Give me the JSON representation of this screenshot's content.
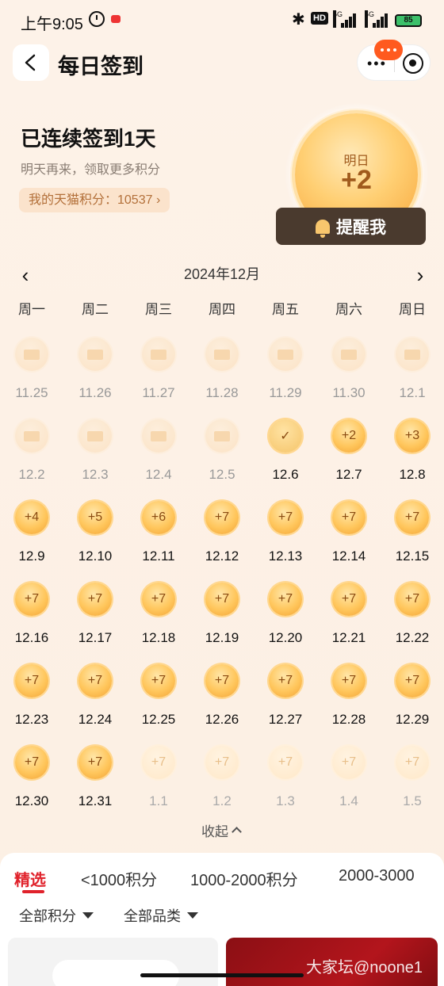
{
  "status_bar": {
    "time": "上午9:05",
    "hd": "HD",
    "net1": "5G",
    "net2": "5G",
    "battery": "85"
  },
  "header": {
    "title": "每日签到"
  },
  "summary": {
    "streak_title": "已连续签到1天",
    "subtitle": "明天再来，领取更多积分",
    "points_label": "我的天猫积分：10537 ›"
  },
  "big_coin": {
    "label": "明日",
    "value": "+2"
  },
  "remind_button": "提醒我",
  "calendar": {
    "month": "2024年12月",
    "prev": "‹",
    "next": "›",
    "weekdays": [
      "周一",
      "周二",
      "周三",
      "周四",
      "周五",
      "周六",
      "周日"
    ],
    "rows": [
      [
        {
          "date": "11.25",
          "reward": "",
          "state": "envelope"
        },
        {
          "date": "11.26",
          "reward": "",
          "state": "envelope"
        },
        {
          "date": "11.27",
          "reward": "",
          "state": "envelope"
        },
        {
          "date": "11.28",
          "reward": "",
          "state": "envelope"
        },
        {
          "date": "11.29",
          "reward": "",
          "state": "envelope"
        },
        {
          "date": "11.30",
          "reward": "",
          "state": "envelope"
        },
        {
          "date": "12.1",
          "reward": "",
          "state": "envelope"
        }
      ],
      [
        {
          "date": "12.2",
          "reward": "",
          "state": "envelope"
        },
        {
          "date": "12.3",
          "reward": "",
          "state": "envelope"
        },
        {
          "date": "12.4",
          "reward": "",
          "state": "envelope"
        },
        {
          "date": "12.5",
          "reward": "",
          "state": "envelope"
        },
        {
          "date": "12.6",
          "reward": "✓",
          "state": "check"
        },
        {
          "date": "12.7",
          "reward": "+2",
          "state": "active"
        },
        {
          "date": "12.8",
          "reward": "+3",
          "state": "active"
        }
      ],
      [
        {
          "date": "12.9",
          "reward": "+4",
          "state": "active"
        },
        {
          "date": "12.10",
          "reward": "+5",
          "state": "active"
        },
        {
          "date": "12.11",
          "reward": "+6",
          "state": "active"
        },
        {
          "date": "12.12",
          "reward": "+7",
          "state": "active"
        },
        {
          "date": "12.13",
          "reward": "+7",
          "state": "active"
        },
        {
          "date": "12.14",
          "reward": "+7",
          "state": "active"
        },
        {
          "date": "12.15",
          "reward": "+7",
          "state": "active"
        }
      ],
      [
        {
          "date": "12.16",
          "reward": "+7",
          "state": "active"
        },
        {
          "date": "12.17",
          "reward": "+7",
          "state": "active"
        },
        {
          "date": "12.18",
          "reward": "+7",
          "state": "active"
        },
        {
          "date": "12.19",
          "reward": "+7",
          "state": "active"
        },
        {
          "date": "12.20",
          "reward": "+7",
          "state": "active"
        },
        {
          "date": "12.21",
          "reward": "+7",
          "state": "active"
        },
        {
          "date": "12.22",
          "reward": "+7",
          "state": "active"
        }
      ],
      [
        {
          "date": "12.23",
          "reward": "+7",
          "state": "active"
        },
        {
          "date": "12.24",
          "reward": "+7",
          "state": "active"
        },
        {
          "date": "12.25",
          "reward": "+7",
          "state": "active"
        },
        {
          "date": "12.26",
          "reward": "+7",
          "state": "active"
        },
        {
          "date": "12.27",
          "reward": "+7",
          "state": "active"
        },
        {
          "date": "12.28",
          "reward": "+7",
          "state": "active"
        },
        {
          "date": "12.29",
          "reward": "+7",
          "state": "active"
        }
      ],
      [
        {
          "date": "12.30",
          "reward": "+7",
          "state": "active"
        },
        {
          "date": "12.31",
          "reward": "+7",
          "state": "active"
        },
        {
          "date": "1.1",
          "reward": "+7",
          "state": "faded"
        },
        {
          "date": "1.2",
          "reward": "+7",
          "state": "faded"
        },
        {
          "date": "1.3",
          "reward": "+7",
          "state": "faded"
        },
        {
          "date": "1.4",
          "reward": "+7",
          "state": "faded"
        },
        {
          "date": "1.5",
          "reward": "+7",
          "state": "faded"
        }
      ]
    ],
    "collapse_label": "收起"
  },
  "tabs": [
    "精选",
    "<1000积分",
    "1000-2000积分",
    "2000-3000"
  ],
  "filters": [
    "全部积分",
    "全部品类"
  ],
  "watermark": "大家坛@noone1",
  "colors": {
    "accent_red": "#e0222b",
    "coin_gold": "#ffc65c",
    "remind_bg": "#4a3a2e",
    "points_text": "#b3703a"
  }
}
